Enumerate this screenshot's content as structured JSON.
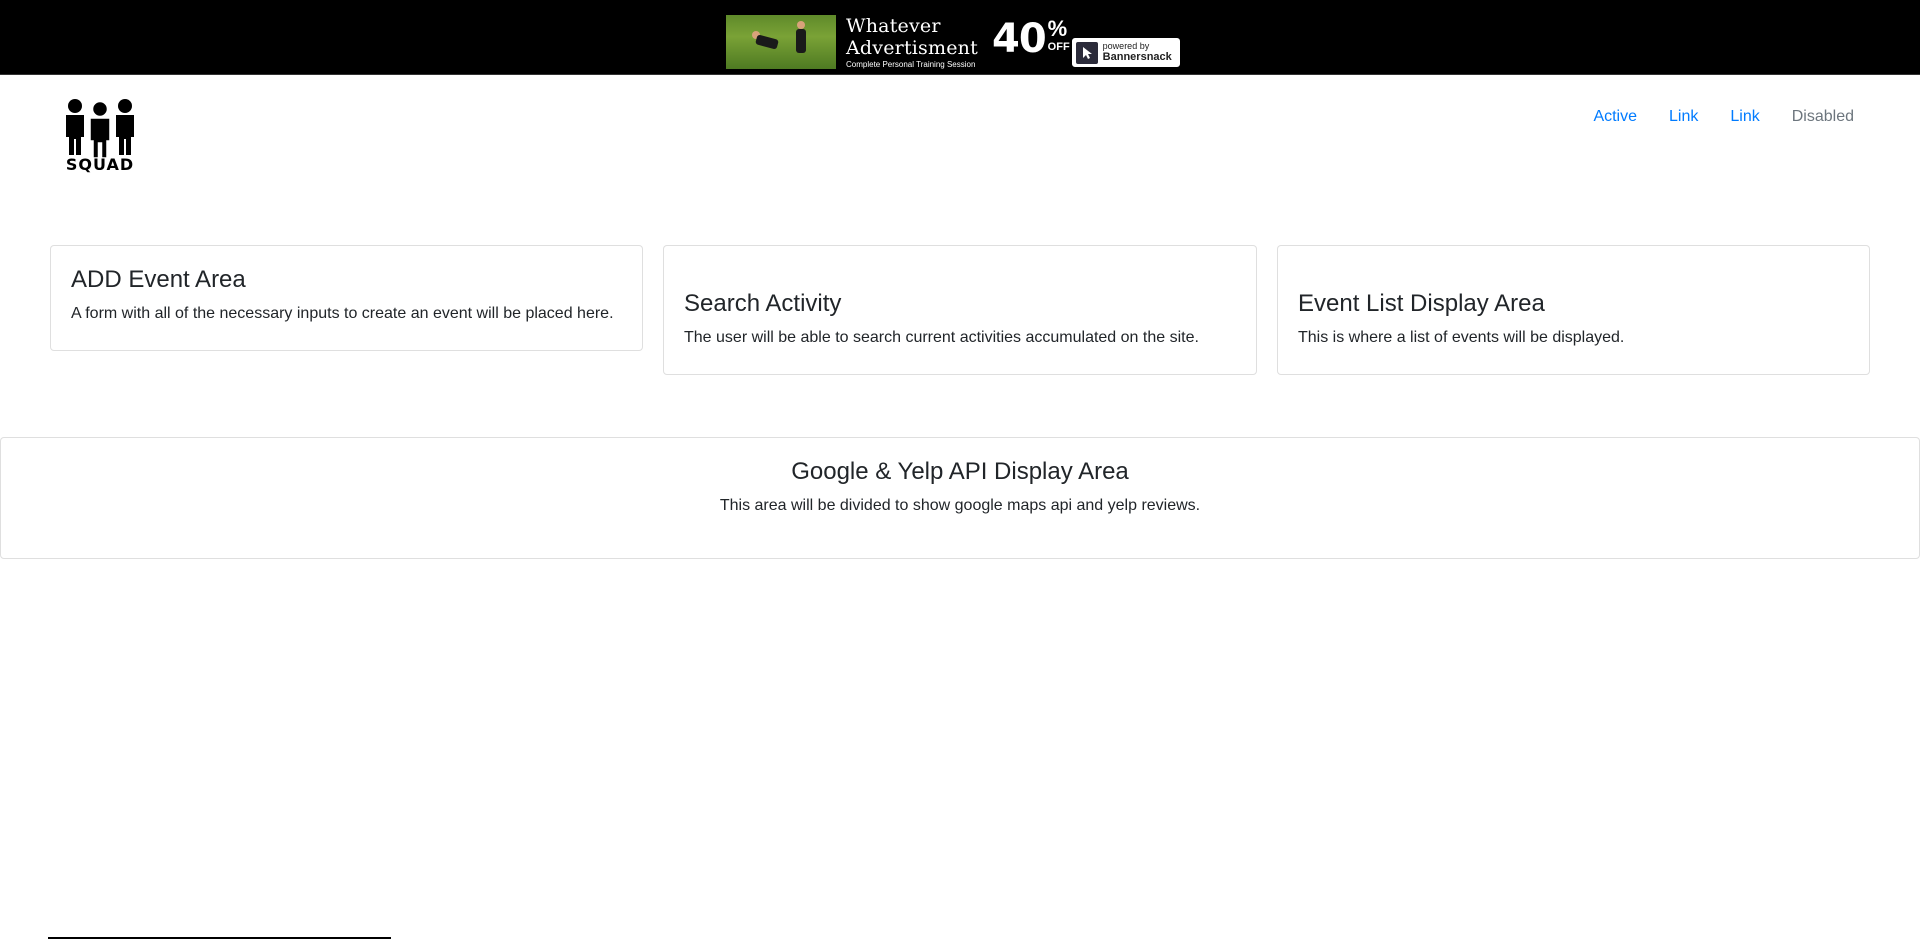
{
  "ad": {
    "title_line1": "Whatever",
    "title_line2": "Advertisment",
    "subtitle": "Complete Personal Training Session",
    "discount_number": "40",
    "discount_percent": "%",
    "discount_off": "OFF",
    "powered_by": "powered by",
    "brand": "Bannersnack"
  },
  "brand": {
    "logo_text": "SQUAD",
    "logo_icon": "three-people-icon"
  },
  "nav": {
    "items": [
      {
        "label": "Active",
        "state": "active"
      },
      {
        "label": "Link",
        "state": "normal"
      },
      {
        "label": "Link",
        "state": "normal"
      },
      {
        "label": "Disabled",
        "state": "disabled"
      }
    ]
  },
  "cards": [
    {
      "title": "ADD Event Area",
      "text": "A form with all of the necessary inputs to create an event will be placed here."
    },
    {
      "title": "Search Activity",
      "text": "The user will be able to search current activities accumulated on the site."
    },
    {
      "title": "Event List Display Area",
      "text": "This is where a list of events will be displayed."
    }
  ],
  "api_card": {
    "title": "Google & Yelp API Display Area",
    "text": "This area will be divided to show google maps api and yelp reviews."
  },
  "colors": {
    "link": "#007bff",
    "disabled": "#6c757d",
    "text": "#212529",
    "ad_background": "#000000"
  }
}
